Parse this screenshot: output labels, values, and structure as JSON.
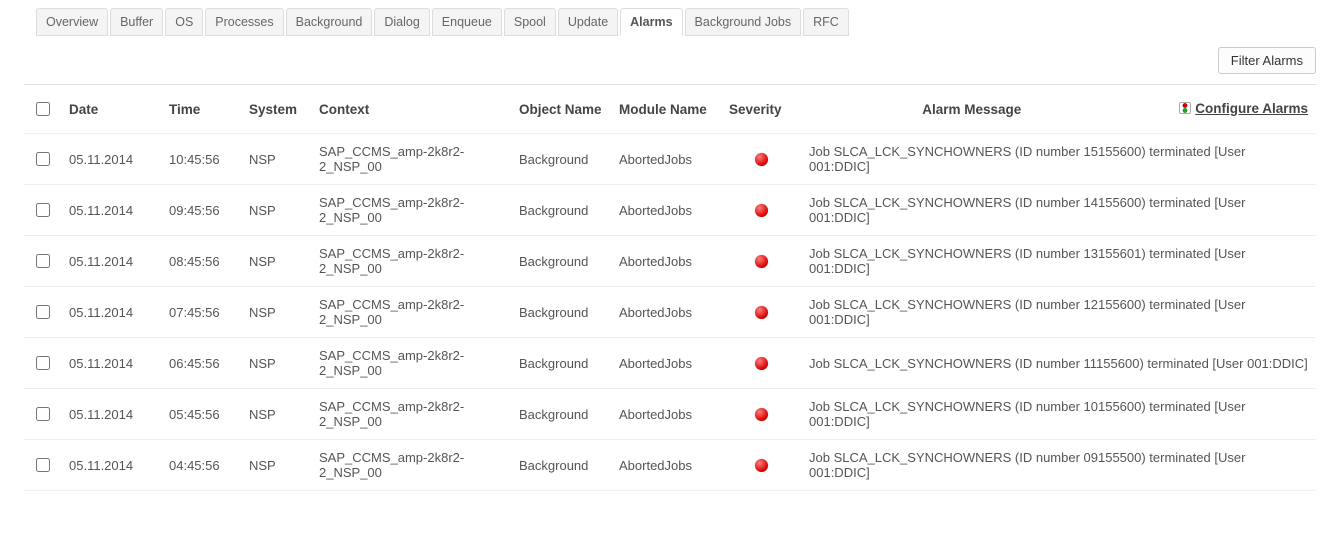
{
  "tabs": [
    {
      "label": "Overview",
      "active": false
    },
    {
      "label": "Buffer",
      "active": false
    },
    {
      "label": "OS",
      "active": false
    },
    {
      "label": "Processes",
      "active": false
    },
    {
      "label": "Background",
      "active": false
    },
    {
      "label": "Dialog",
      "active": false
    },
    {
      "label": "Enqueue",
      "active": false
    },
    {
      "label": "Spool",
      "active": false
    },
    {
      "label": "Update",
      "active": false
    },
    {
      "label": "Alarms",
      "active": true
    },
    {
      "label": "Background Jobs",
      "active": false
    },
    {
      "label": "RFC",
      "active": false
    }
  ],
  "toolbar": {
    "filter_button": "Filter Alarms"
  },
  "table": {
    "headers": {
      "date": "Date",
      "time": "Time",
      "system": "System",
      "context": "Context",
      "object": "Object Name",
      "module": "Module Name",
      "severity": "Severity",
      "message": "Alarm Message",
      "configure": "Configure Alarms"
    },
    "rows": [
      {
        "date": "05.11.2014",
        "time": "10:45:56",
        "system": "NSP",
        "context": "SAP_CCMS_amp-2k8r2-2_NSP_00",
        "object": "Background",
        "module": "AbortedJobs",
        "severity": "red",
        "message": "Job SLCA_LCK_SYNCHOWNERS (ID number 15155600) terminated [User 001:DDIC]"
      },
      {
        "date": "05.11.2014",
        "time": "09:45:56",
        "system": "NSP",
        "context": "SAP_CCMS_amp-2k8r2-2_NSP_00",
        "object": "Background",
        "module": "AbortedJobs",
        "severity": "red",
        "message": "Job SLCA_LCK_SYNCHOWNERS (ID number 14155600) terminated [User 001:DDIC]"
      },
      {
        "date": "05.11.2014",
        "time": "08:45:56",
        "system": "NSP",
        "context": "SAP_CCMS_amp-2k8r2-2_NSP_00",
        "object": "Background",
        "module": "AbortedJobs",
        "severity": "red",
        "message": "Job SLCA_LCK_SYNCHOWNERS (ID number 13155601) terminated [User 001:DDIC]"
      },
      {
        "date": "05.11.2014",
        "time": "07:45:56",
        "system": "NSP",
        "context": "SAP_CCMS_amp-2k8r2-2_NSP_00",
        "object": "Background",
        "module": "AbortedJobs",
        "severity": "red",
        "message": "Job SLCA_LCK_SYNCHOWNERS (ID number 12155600) terminated [User 001:DDIC]"
      },
      {
        "date": "05.11.2014",
        "time": "06:45:56",
        "system": "NSP",
        "context": "SAP_CCMS_amp-2k8r2-2_NSP_00",
        "object": "Background",
        "module": "AbortedJobs",
        "severity": "red",
        "message": "Job SLCA_LCK_SYNCHOWNERS (ID number 11155600) terminated [User 001:DDIC]"
      },
      {
        "date": "05.11.2014",
        "time": "05:45:56",
        "system": "NSP",
        "context": "SAP_CCMS_amp-2k8r2-2_NSP_00",
        "object": "Background",
        "module": "AbortedJobs",
        "severity": "red",
        "message": "Job SLCA_LCK_SYNCHOWNERS (ID number 10155600) terminated [User 001:DDIC]"
      },
      {
        "date": "05.11.2014",
        "time": "04:45:56",
        "system": "NSP",
        "context": "SAP_CCMS_amp-2k8r2-2_NSP_00",
        "object": "Background",
        "module": "AbortedJobs",
        "severity": "red",
        "message": "Job SLCA_LCK_SYNCHOWNERS (ID number 09155500) terminated [User 001:DDIC]"
      }
    ]
  }
}
